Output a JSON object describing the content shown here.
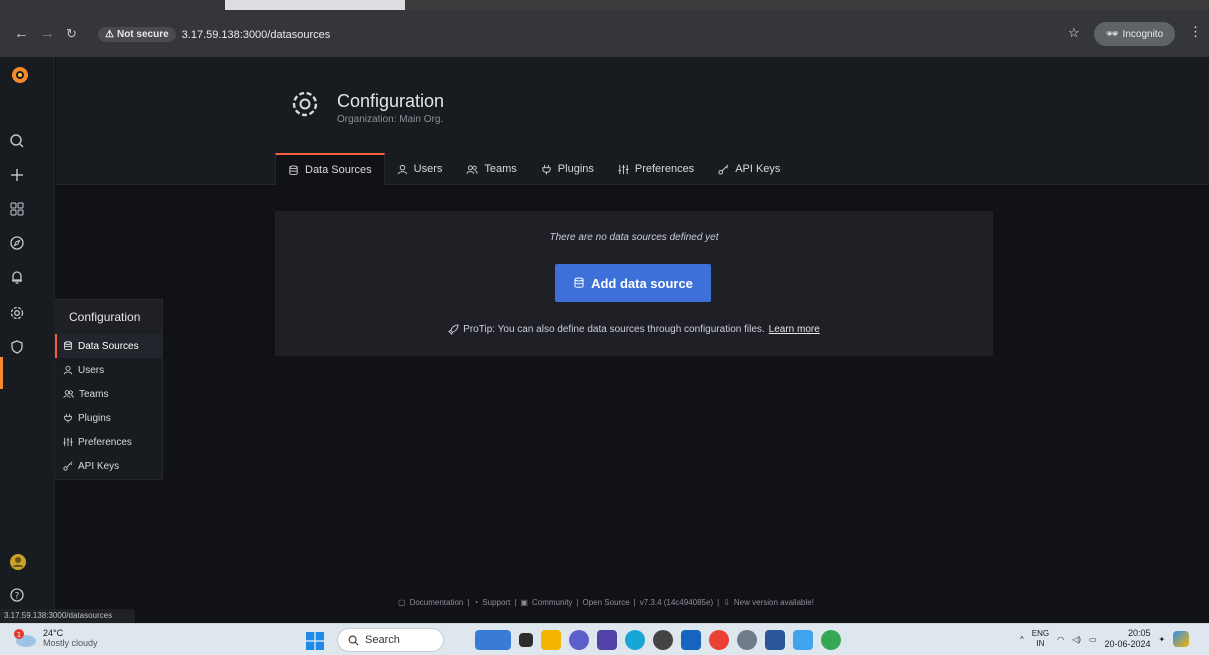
{
  "browser": {
    "security_label": "Not secure",
    "url": "3.17.59.138:3000/datasources",
    "incognito_label": "Incognito",
    "status_url": "3.17.59.138:3000/datasources"
  },
  "page": {
    "title": "Configuration",
    "subtitle": "Organization: Main Org."
  },
  "tabs": [
    {
      "label": "Data Sources",
      "icon": "database-icon",
      "active": true
    },
    {
      "label": "Users",
      "icon": "user-icon"
    },
    {
      "label": "Teams",
      "icon": "users-icon"
    },
    {
      "label": "Plugins",
      "icon": "plug-icon"
    },
    {
      "label": "Preferences",
      "icon": "sliders-icon"
    },
    {
      "label": "API Keys",
      "icon": "key-icon"
    }
  ],
  "empty_state": {
    "message": "There are no data sources defined yet",
    "button_label": "Add data source",
    "protip": "ProTip: You can also define data sources through configuration files.",
    "learn_more": "Learn more"
  },
  "flyout": {
    "title": "Configuration",
    "items": [
      "Data Sources",
      "Users",
      "Teams",
      "Plugins",
      "Preferences",
      "API Keys"
    ]
  },
  "footer": {
    "documentation": "Documentation",
    "support": "Support",
    "community": "Community",
    "open_source": "Open Source",
    "version": "v7.3.4 (14c494085e)",
    "new_version": "New version available!",
    "separator": "|"
  },
  "taskbar": {
    "temperature": "24°C",
    "weather": "Mostly cloudy",
    "search_placeholder": "Search",
    "lang_top": "ENG",
    "lang_bottom": "IN",
    "time": "20:05",
    "date": "20-06-2024"
  },
  "colors": {
    "accent": "#f55f3e",
    "primary_button": "#3d71d9",
    "background": "#111217"
  }
}
